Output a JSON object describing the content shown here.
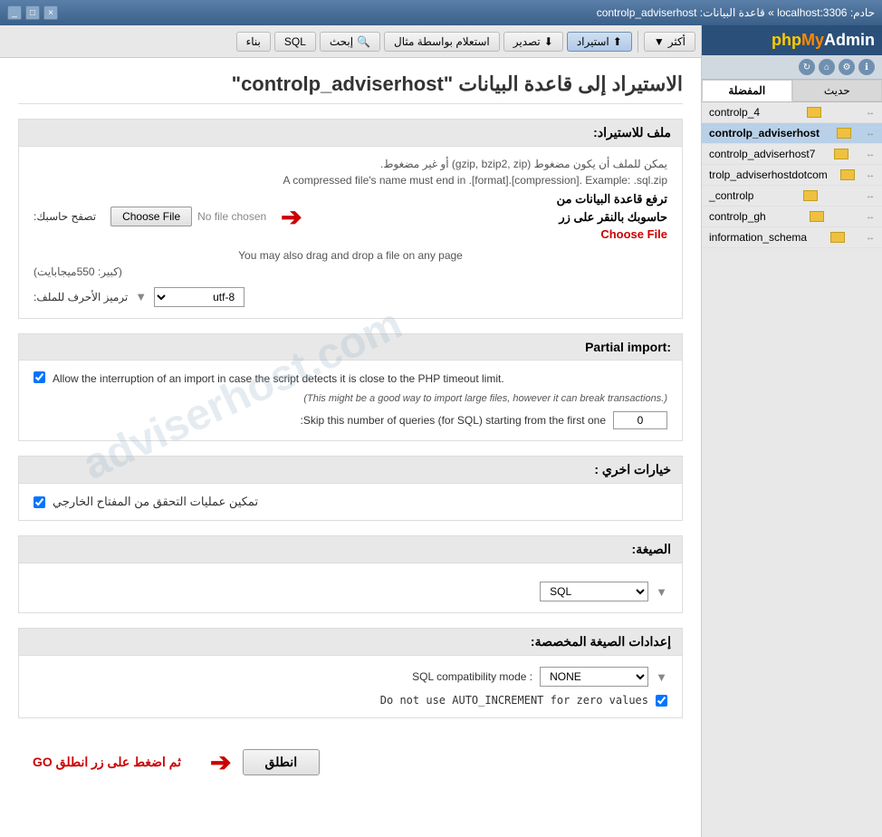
{
  "titlebar": {
    "text": "حادم: localhost:3306 » قاعدة البيانات: controlp_adviserhost",
    "buttons": [
      "_",
      "□",
      "×"
    ]
  },
  "toolbar": {
    "items": [
      {
        "id": "build",
        "label": "بناء",
        "icon": "🔨"
      },
      {
        "id": "sql",
        "label": "SQL",
        "icon": ""
      },
      {
        "id": "search",
        "label": "إبحث",
        "icon": "🔍"
      },
      {
        "id": "query",
        "label": "استعلام بواسطة مثال",
        "icon": ""
      },
      {
        "id": "export",
        "label": "تصدير",
        "icon": ""
      },
      {
        "id": "import",
        "label": "استيراد",
        "active": true,
        "icon": ""
      },
      {
        "id": "more",
        "label": "أكثر",
        "icon": "▼"
      }
    ]
  },
  "page": {
    "title": "الاستيراد إلى قاعدة البيانات \"controlp_adviserhost\""
  },
  "file_section": {
    "header": "ملف للاستيراد:",
    "compressed_note": "يمكن للملف أن يكون مضغوط (gzip, bzip2, zip) أو غير مضغوط.",
    "format_note": "A compressed file's name must end in .[format].[compression]. Example: .sql.zip",
    "file_label": "تصفح حاسبك:",
    "no_file_text": "No file chosen",
    "choose_file_btn": "Choose File",
    "drag_drop_text": "You may also drag and drop a file on any page",
    "size_note": "(كبير: 550ميجابايت)",
    "charset_label": "ترميز الأحرف للملف:",
    "charset_value": "utf-8"
  },
  "annotation": {
    "text_line1": "ترفع قاعدة البيانات من",
    "text_line2": "حاسوبك بالنقر على زر",
    "text_choose": "Choose File"
  },
  "partial_import": {
    "header": "Partial import:",
    "allow_interrupt_label": "Allow the interruption of an import in case the script detects it is close to the PHP timeout limit.",
    "italic_note": "(This might be a good way to import large files, however it can break transactions.)",
    "skip_label": ":Skip this number of queries (for SQL) starting from the first one",
    "skip_value": "0"
  },
  "other_options": {
    "header": "خيارات اخري :",
    "enable_foreign_label": "تمكين عمليات التحقق من المفتاح الخارجي"
  },
  "format_section": {
    "header": "الصيغة:",
    "format_value": "SQL"
  },
  "custom_format": {
    "header": "إعدادات الصيغة المخصصة:",
    "sql_mode_label": "SQL compatibility mode :",
    "sql_mode_value": "NONE",
    "auto_increment_label": "Do not use AUTO_INCREMENT for zero values"
  },
  "footer": {
    "annotation": "ثم اضغط على زر انطلق GO",
    "go_btn": "انطلق"
  },
  "sidebar": {
    "logo": "phpMyAdmin",
    "tabs": [
      {
        "id": "recent",
        "label": "حديث"
      },
      {
        "id": "favorites",
        "label": "المفضلة",
        "active": true
      }
    ],
    "databases": [
      {
        "name": "controlp_4",
        "active": false
      },
      {
        "name": "controlp_adviserhost",
        "active": true
      },
      {
        "name": "controlp_adviserhost7",
        "active": false
      },
      {
        "name": "trolp_adviserhostdotcom",
        "active": false
      },
      {
        "name": "controlp_",
        "active": false
      },
      {
        "name": "controlp_gh",
        "active": false
      },
      {
        "name": "information_schema",
        "active": false
      }
    ]
  }
}
